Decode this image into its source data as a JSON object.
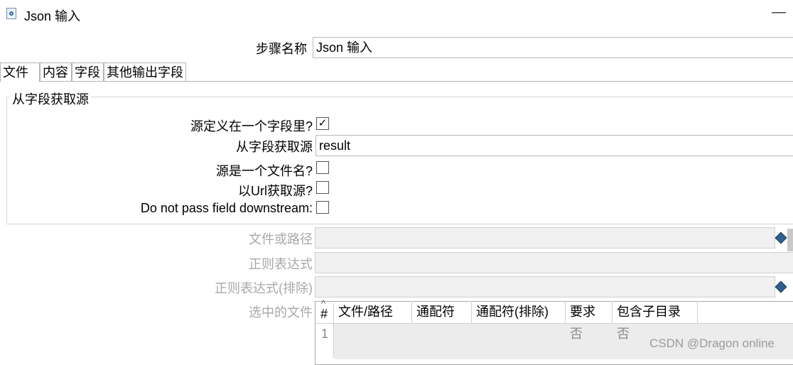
{
  "window": {
    "title": "Json 输入",
    "icon": "json-input-icon",
    "minimize_label": "—"
  },
  "step_name": {
    "label": "步骤名称",
    "value": "Json 输入"
  },
  "tabs": [
    {
      "label": "文件",
      "active": true
    },
    {
      "label": "内容",
      "active": false
    },
    {
      "label": "字段",
      "active": false
    },
    {
      "label": "其他输出字段",
      "active": false
    }
  ],
  "source_group": {
    "title": "从字段获取源",
    "source_in_field": {
      "label": "源定义在一个字段里?",
      "checked": true,
      "mark": "✓"
    },
    "field_source": {
      "label": "从字段获取源",
      "value": "result"
    },
    "source_is_filename": {
      "label": "源是一个文件名?",
      "checked": false
    },
    "read_from_url": {
      "label": "以Url获取源?",
      "checked": false
    },
    "do_not_pass": {
      "label": "Do not pass field downstream:",
      "checked": false
    }
  },
  "file_section": {
    "file_or_dir": {
      "label": "文件或路径",
      "value": ""
    },
    "regex": {
      "label": "正则表达式",
      "value": ""
    },
    "regex_exclude": {
      "label": "正则表达式(排除)",
      "value": ""
    },
    "selected_files_label": "选中的文件"
  },
  "files_table": {
    "sort_indicator": "^",
    "columns": [
      "#",
      "文件/路径",
      "通配符",
      "通配符(排除)",
      "要求",
      "包含子目录"
    ],
    "rows": [
      {
        "num": "1",
        "path": "",
        "wildcard": "",
        "exclude": "",
        "required": "否",
        "subdirs": "否"
      }
    ]
  },
  "watermark": "CSDN @Dragon online",
  "colors": {
    "border": "#b4b4b4",
    "disabled_bg": "#f0f0f0",
    "diamond": "#2f5f8f"
  }
}
